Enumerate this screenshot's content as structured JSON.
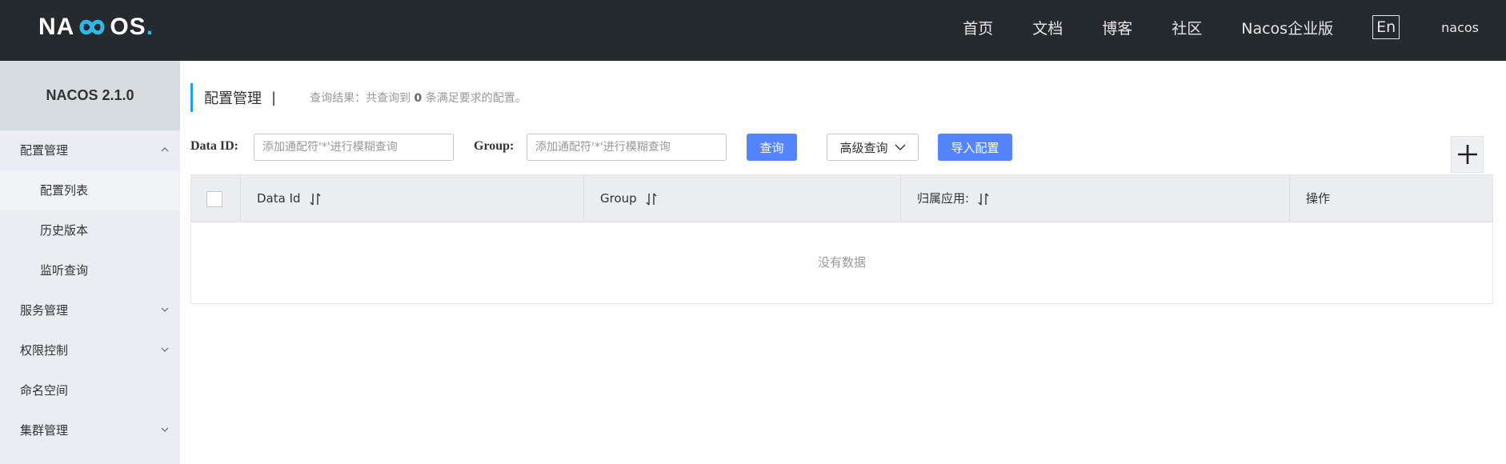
{
  "header": {
    "logo_text_left": "NA",
    "logo_text_right": "OS",
    "logo_dot": ".",
    "nav": [
      "首页",
      "文档",
      "博客",
      "社区",
      "Nacos企业版"
    ],
    "lang_button": "En",
    "user": "nacos"
  },
  "sidebar": {
    "version_title": "NACOS 2.1.0",
    "groups": [
      {
        "label": "配置管理",
        "expanded": true,
        "children": [
          "配置列表",
          "历史版本",
          "监听查询"
        ],
        "active_child": "配置列表"
      },
      {
        "label": "服务管理",
        "expanded": false
      },
      {
        "label": "权限控制",
        "expanded": false
      },
      {
        "label": "命名空间",
        "expanded": false
      },
      {
        "label": "集群管理",
        "expanded": false
      }
    ]
  },
  "page": {
    "title": "配置管理",
    "separator": "|",
    "result_prefix": "查询结果：共查询到",
    "result_count": "0",
    "result_suffix": "条满足要求的配置。"
  },
  "search": {
    "data_id_label": "Data ID:",
    "data_id_placeholder": "添加通配符'*'进行模糊查询",
    "group_label": "Group:",
    "group_placeholder": "添加通配符'*'进行模糊查询",
    "query_button": "查询",
    "advanced_button": "高级查询",
    "import_button": "导入配置"
  },
  "table": {
    "columns": [
      "Data Id",
      "Group",
      "归属应用:",
      "操作"
    ],
    "empty_text": "没有数据"
  },
  "colors": {
    "topbar": "#252a2f",
    "sidebar": "#eaedf1",
    "primary": "#5584ff",
    "accent": "#209bfa"
  }
}
